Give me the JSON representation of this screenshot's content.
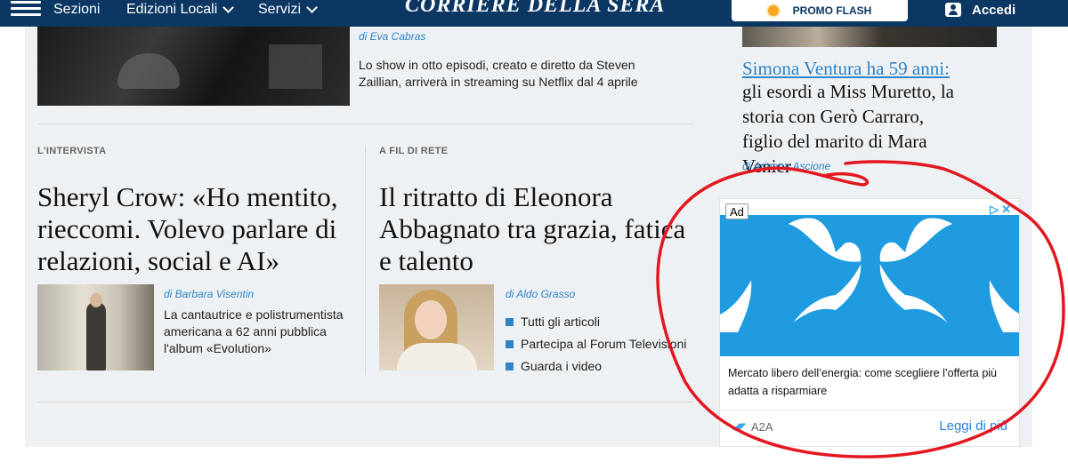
{
  "header": {
    "menu_label": "Sezioni",
    "local_label": "Edizioni Locali",
    "services_label": "Servizi",
    "logo_text": "CORRIERE DELLA SERA",
    "promo_label": "PROMO FLASH",
    "login_label": "Accedi",
    "colors": {
      "bar": "#0c3763",
      "accent": "#2f83c6"
    }
  },
  "top_article": {
    "byline": "di Eva Cabras",
    "summary": "Lo show in otto episodi, creato e diretto da Steven Zaillian, arriverà in streaming su Netflix dal 4 aprile"
  },
  "article_left": {
    "kicker": "L'INTERVISTA",
    "headline": "Sheryl Crow: «Ho mentito, rieccomi. Volevo parlare di relazioni, social e AI»",
    "byline": "di Barbara Visentin",
    "summary": "La cantautrice e polistrumentista americana a 62 anni pubblica l'album «Evolution»"
  },
  "article_mid": {
    "kicker": "A FIL DI RETE",
    "headline": "Il ritratto di Eleonora Abbagnato tra grazia, fatica e talento",
    "byline": "di Aldo Grasso",
    "links": [
      "Tutti gli articoli",
      "Partecipa al Forum Televisioni",
      "Guarda i video"
    ]
  },
  "article_right": {
    "headline_link": "Simona Ventura ha 59 anni:",
    "headline": "gli esordi a Miss Muretto, la storia con Gerò Carraro, figlio del marito di Mara Venier",
    "byline": "di Arianna Ascione"
  },
  "ad": {
    "badge": "Ad",
    "choices": "▷✕",
    "title": "Mercato libero dell’energia: come scegliere l’offerta più adatta a risparmiare",
    "brand": "A2A",
    "cta": "Leggi di più",
    "image_color": "#1f9be0"
  }
}
